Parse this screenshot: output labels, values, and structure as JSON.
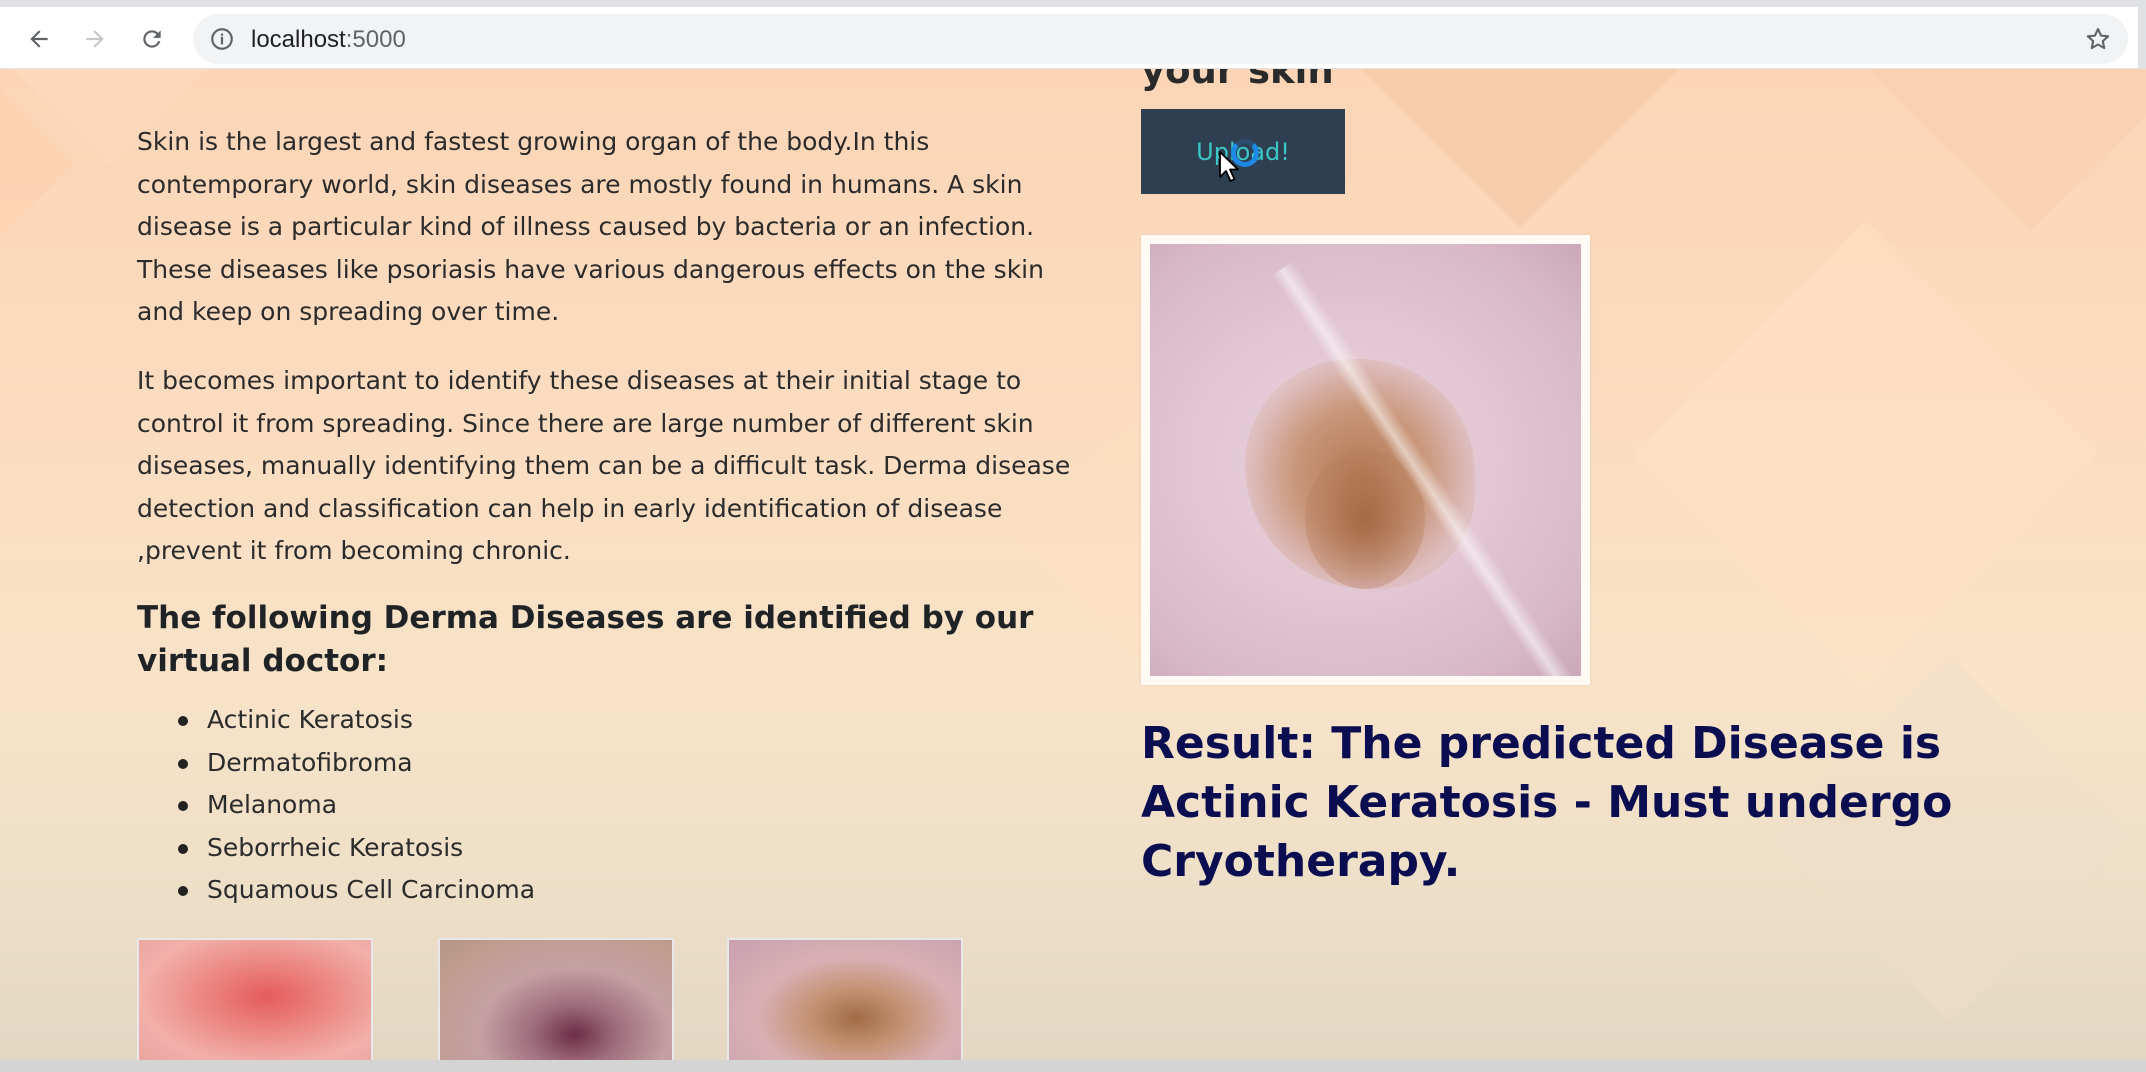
{
  "browser": {
    "url_host": "localhost",
    "url_port": ":5000"
  },
  "page": {
    "partial_heading": "your skin",
    "intro_paragraphs": [
      "Skin is the largest and fastest growing organ of the body.In this contemporary world, skin diseases are mostly found in humans. A skin disease is a particular kind of illness caused by bacteria or an infection. These diseases like psoriasis have various dangerous effects on the skin and keep on spreading over time.",
      "It becomes important to identify these diseases at their initial stage to control it from spreading. Since there are large number of different skin diseases, manually identifying them can be a difficult task. Derma disease detection and classification can help in early identification of disease ,prevent it from becoming chronic."
    ],
    "diseases_heading": "The following Derma Diseases are identified by our virtual doctor:",
    "diseases": [
      "Actinic Keratosis",
      "Dermatofibroma",
      "Melanoma",
      "Seborrheic Keratosis",
      "Squamous Cell Carcinoma"
    ],
    "upload_label": "Upload!",
    "result_text": "Result: The predicted Disease is Actinic Keratosis - Must undergo Cryotherapy."
  },
  "icons": {
    "back": "arrow-left-icon",
    "forward": "arrow-right-icon",
    "reload": "reload-icon",
    "site_info": "info-icon",
    "bookmark": "star-icon",
    "loading": "spinner-icon",
    "cursor": "mouse-pointer-icon"
  },
  "colors": {
    "upload_bg": "#2f3f52",
    "upload_text": "#39c6c4",
    "result_text": "#0a0d50",
    "spinner": "#1e88e5"
  }
}
